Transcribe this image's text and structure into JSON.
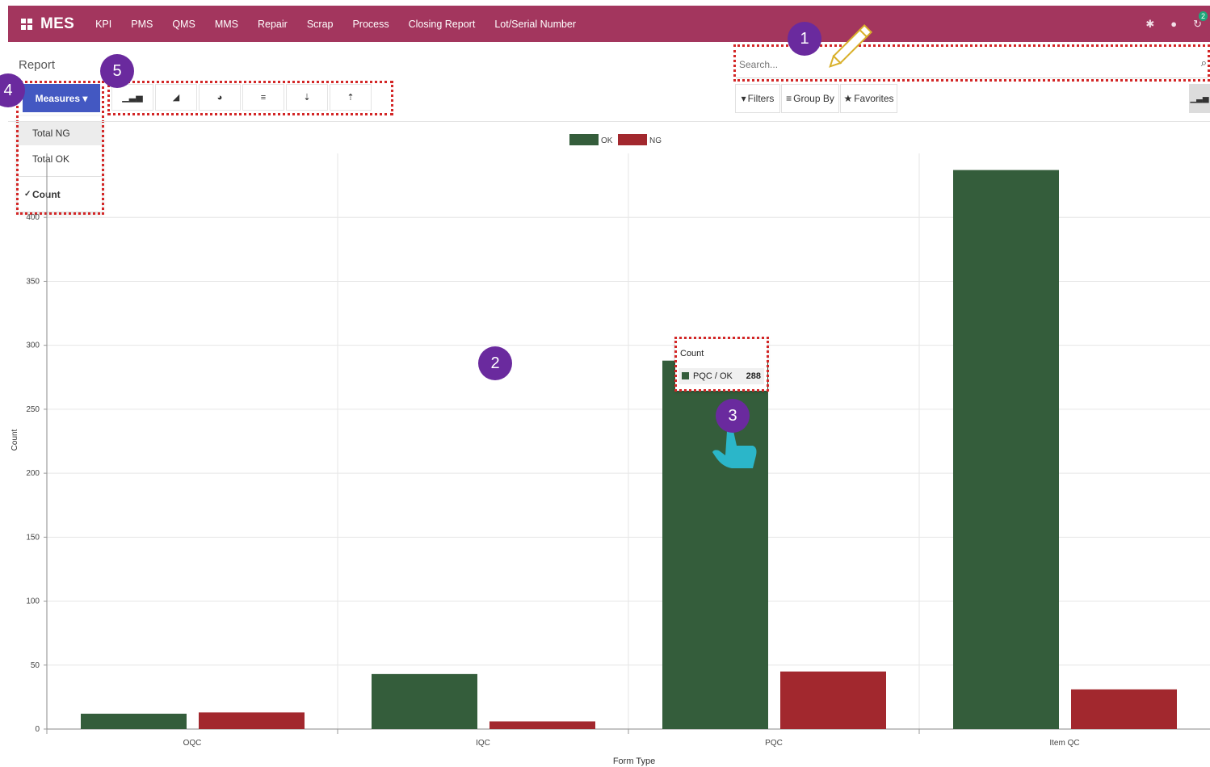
{
  "app": {
    "brand": "MES"
  },
  "nav": [
    "KPI",
    "PMS",
    "QMS",
    "MMS",
    "Repair",
    "Scrap",
    "Process",
    "Closing Report",
    "Lot/Serial Number"
  ],
  "systray": {
    "chat_badge": "2"
  },
  "page_title": "Report",
  "search": {
    "placeholder": "Search..."
  },
  "measures": {
    "label": "Measures ▾",
    "items": [
      {
        "label": "Total NG",
        "checked": false
      },
      {
        "label": "Total OK",
        "checked": false
      },
      {
        "label": "Count",
        "checked": true
      }
    ]
  },
  "chart_buttons": [
    "bar-chart-icon",
    "area-chart-icon",
    "pie-chart-icon",
    "database-icon",
    "sort-descending-icon",
    "sort-ascending-icon"
  ],
  "search_panel": {
    "filters": "Filters",
    "group_by": "Group By",
    "favorites": "Favorites"
  },
  "markers": [
    "1",
    "2",
    "3",
    "4",
    "5"
  ],
  "tooltip": {
    "title": "Count",
    "label": "PQC / OK",
    "value": "288"
  },
  "colors": {
    "navbar": "#a3365e",
    "ok": "#345d3b",
    "ng": "#a2282e",
    "marker": "#6a2a9e",
    "highlight": "#d32626",
    "primary": "#4358c2"
  },
  "chart_data": {
    "type": "bar",
    "categories": [
      "OQC",
      "IQC",
      "PQC",
      "Item QC"
    ],
    "series": [
      {
        "name": "OK",
        "values": [
          12,
          43,
          288,
          437
        ]
      },
      {
        "name": "NG",
        "values": [
          13,
          6,
          45,
          31
        ]
      }
    ],
    "xlabel": "Form Type",
    "ylabel": "Count",
    "ylim": [
      0,
      450
    ],
    "yticks": [
      0,
      50,
      100,
      150,
      200,
      250,
      300,
      350,
      400
    ],
    "legend": "top-center",
    "grid": true
  }
}
